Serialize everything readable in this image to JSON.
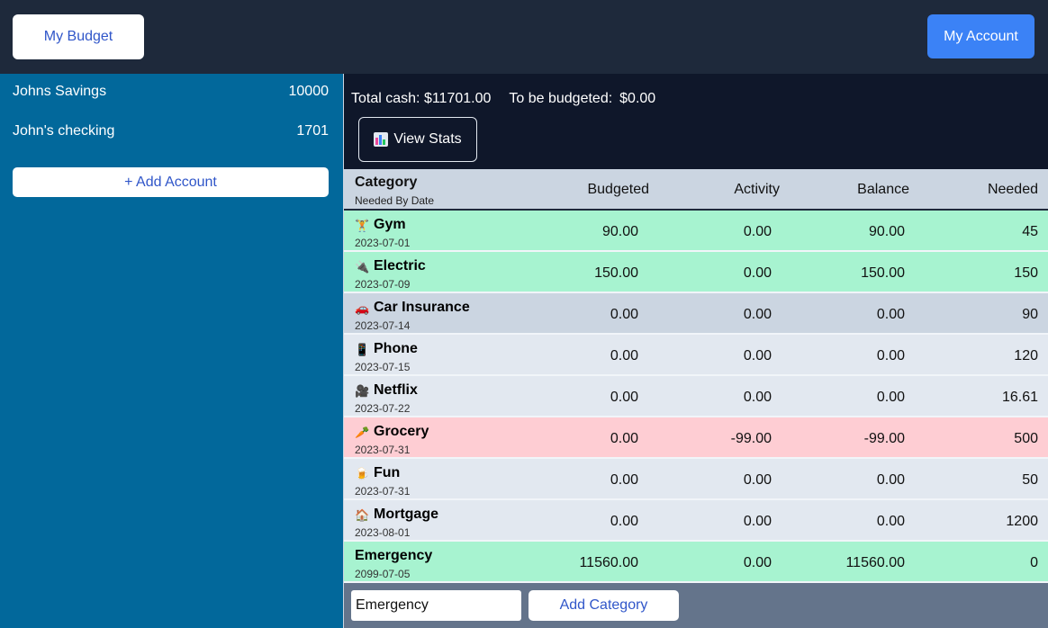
{
  "header": {
    "my_budget_label": "My Budget",
    "my_account_label": "My Account"
  },
  "sidebar": {
    "accounts": [
      {
        "name": "Johns Savings",
        "balance": "10000"
      },
      {
        "name": "John's checking",
        "balance": "1701"
      }
    ],
    "add_account_label": "+ Add Account"
  },
  "summary": {
    "total_cash_label": "Total cash:",
    "total_cash_value": "$11701.00",
    "to_be_budgeted_label": "To be budgeted:",
    "to_be_budgeted_value": "$0.00"
  },
  "stats_button": {
    "label": "View Stats",
    "icon": "bar-chart-icon"
  },
  "table": {
    "headers": {
      "category": "Category",
      "needed_by_date": "Needed By Date",
      "budgeted": "Budgeted",
      "activity": "Activity",
      "balance": "Balance",
      "needed": "Needed"
    },
    "rows": [
      {
        "icon": "🏋",
        "name": "Gym",
        "date": "2023-07-01",
        "budgeted": "90.00",
        "activity": "0.00",
        "balance": "90.00",
        "needed": "45",
        "status": "green"
      },
      {
        "icon": "🔌",
        "name": "Electric",
        "date": "2023-07-09",
        "budgeted": "150.00",
        "activity": "0.00",
        "balance": "150.00",
        "needed": "150",
        "status": "green"
      },
      {
        "icon": "🚗",
        "name": "Car Insurance",
        "date": "2023-07-14",
        "budgeted": "0.00",
        "activity": "0.00",
        "balance": "0.00",
        "needed": "90",
        "status": "gray"
      },
      {
        "icon": "📱",
        "name": "Phone",
        "date": "2023-07-15",
        "budgeted": "0.00",
        "activity": "0.00",
        "balance": "0.00",
        "needed": "120",
        "status": "light"
      },
      {
        "icon": "🎥",
        "name": "Netflix",
        "date": "2023-07-22",
        "budgeted": "0.00",
        "activity": "0.00",
        "balance": "0.00",
        "needed": "16.61",
        "status": "light"
      },
      {
        "icon": "🥕",
        "name": "Grocery",
        "date": "2023-07-31",
        "budgeted": "0.00",
        "activity": "-99.00",
        "balance": "-99.00",
        "needed": "500",
        "status": "pink"
      },
      {
        "icon": "🍺",
        "name": "Fun",
        "date": "2023-07-31",
        "budgeted": "0.00",
        "activity": "0.00",
        "balance": "0.00",
        "needed": "50",
        "status": "light"
      },
      {
        "icon": "🏠",
        "name": "Mortgage",
        "date": "2023-08-01",
        "budgeted": "0.00",
        "activity": "0.00",
        "balance": "0.00",
        "needed": "1200",
        "status": "light"
      },
      {
        "icon": "",
        "name": "Emergency",
        "date": "2099-07-05",
        "budgeted": "11560.00",
        "activity": "0.00",
        "balance": "11560.00",
        "needed": "0",
        "status": "green"
      }
    ]
  },
  "footer": {
    "category_input_value": "Emergency",
    "add_category_label": "Add Category"
  },
  "colors": {
    "topbar": "#1e293b",
    "sidebar": "#02689b",
    "main_bg": "#0f172a",
    "accent_blue": "#3b82f6",
    "row_green": "#a7f3d0",
    "row_pink": "#fecdd3",
    "row_gray": "#cbd5e1",
    "row_light": "#e2e8f0"
  }
}
